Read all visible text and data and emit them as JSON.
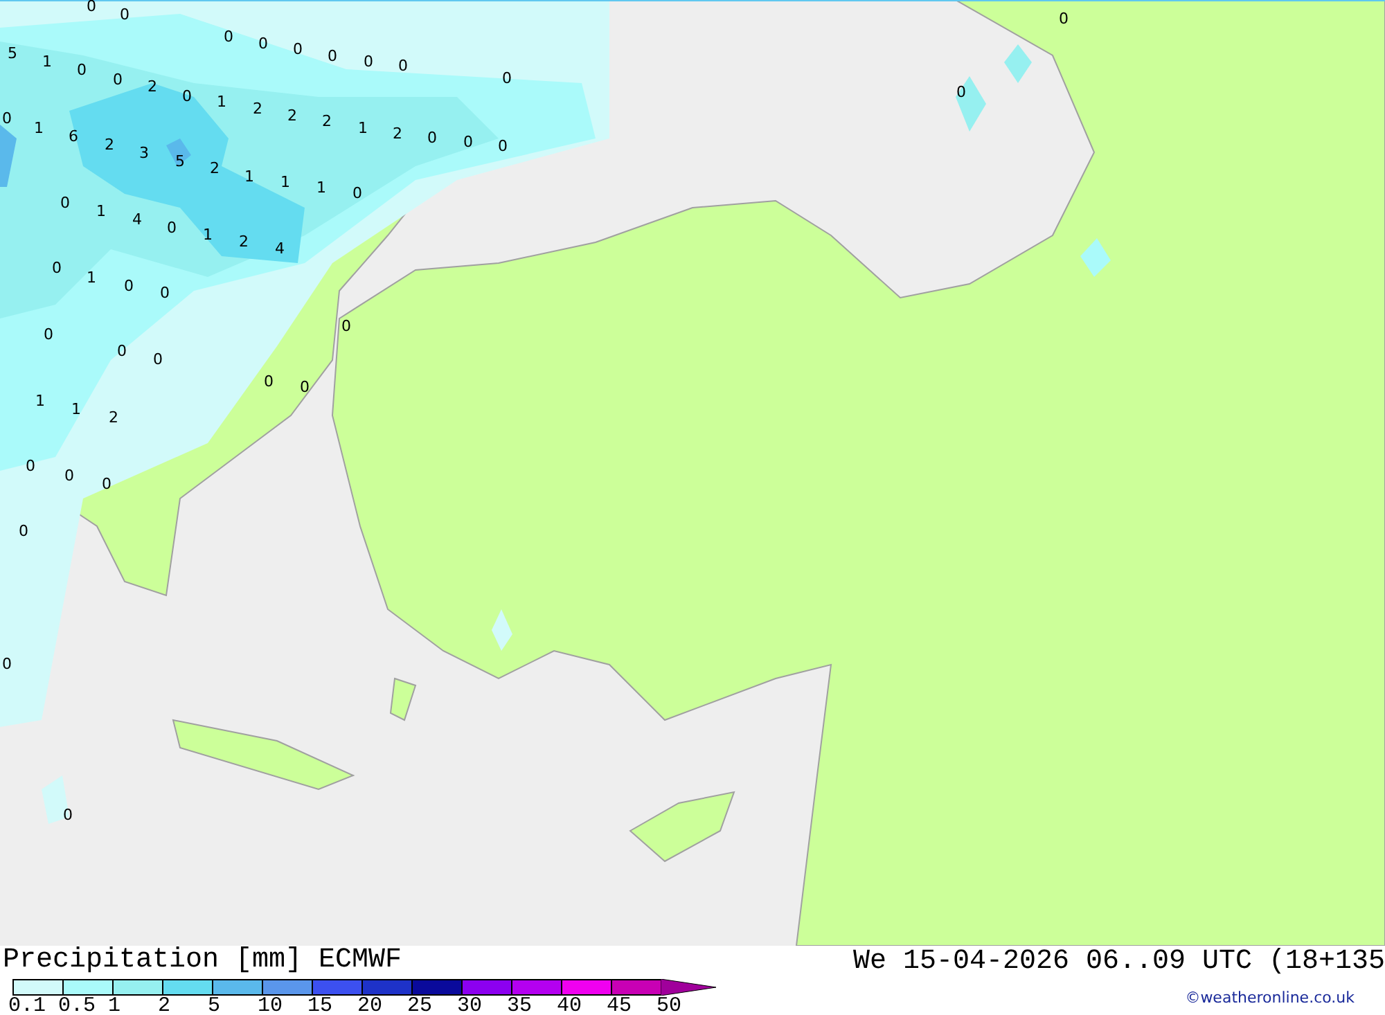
{
  "map": {
    "labels": [
      {
        "text": "0"
      },
      {
        "text": "0"
      },
      {
        "text": "5"
      },
      {
        "text": "1"
      },
      {
        "text": "0"
      },
      {
        "text": "0"
      },
      {
        "text": "2"
      },
      {
        "text": "0"
      },
      {
        "text": "0"
      },
      {
        "text": "0"
      },
      {
        "text": "0"
      },
      {
        "text": "0"
      },
      {
        "text": "0"
      },
      {
        "text": "0"
      },
      {
        "text": "0"
      },
      {
        "text": "1"
      },
      {
        "text": "2"
      },
      {
        "text": "2"
      },
      {
        "text": "2"
      },
      {
        "text": "1"
      },
      {
        "text": "2"
      },
      {
        "text": "0"
      },
      {
        "text": "0"
      },
      {
        "text": "0"
      },
      {
        "text": "0"
      },
      {
        "text": "1"
      },
      {
        "text": "6"
      },
      {
        "text": "2"
      },
      {
        "text": "3"
      },
      {
        "text": "5"
      },
      {
        "text": "2"
      },
      {
        "text": "1"
      },
      {
        "text": "1"
      },
      {
        "text": "1"
      },
      {
        "text": "0"
      },
      {
        "text": "0"
      },
      {
        "text": "1"
      },
      {
        "text": "4"
      },
      {
        "text": "0"
      },
      {
        "text": "1"
      },
      {
        "text": "2"
      },
      {
        "text": "4"
      },
      {
        "text": "0"
      },
      {
        "text": "1"
      },
      {
        "text": "0"
      },
      {
        "text": "0"
      },
      {
        "text": "0"
      },
      {
        "text": "0"
      },
      {
        "text": "0"
      },
      {
        "text": "0"
      },
      {
        "text": "0"
      },
      {
        "text": "0"
      },
      {
        "text": "1"
      },
      {
        "text": "1"
      },
      {
        "text": "2"
      },
      {
        "text": "0"
      },
      {
        "text": "0"
      },
      {
        "text": "0"
      },
      {
        "text": "0"
      },
      {
        "text": "0"
      },
      {
        "text": "0"
      },
      {
        "text": "0"
      },
      {
        "text": "0"
      }
    ]
  },
  "legend": {
    "title": "Precipitation [mm] ECMWF",
    "bins": [
      {
        "color": "#d2fafa"
      },
      {
        "color": "#aafafa"
      },
      {
        "color": "#96f0f0"
      },
      {
        "color": "#64dcf0"
      },
      {
        "color": "#5ab9eb"
      },
      {
        "color": "#5a96eb"
      },
      {
        "color": "#3c50f0"
      },
      {
        "color": "#1e32c8"
      },
      {
        "color": "#0a0a9b"
      },
      {
        "color": "#8c00f0"
      },
      {
        "color": "#b400f0"
      },
      {
        "color": "#f000f0"
      },
      {
        "color": "#c800b4"
      },
      {
        "color": "#a0009b",
        "kind": "arrow"
      }
    ],
    "ticks": [
      "0.1",
      "0.5",
      "1",
      "2",
      "5",
      "10",
      "15",
      "20",
      "25",
      "30",
      "35",
      "40",
      "45",
      "50"
    ]
  },
  "valid_time": "We 15-04-2026 06..09 UTC (18+135",
  "credit": "©weatheronline.co.uk"
}
